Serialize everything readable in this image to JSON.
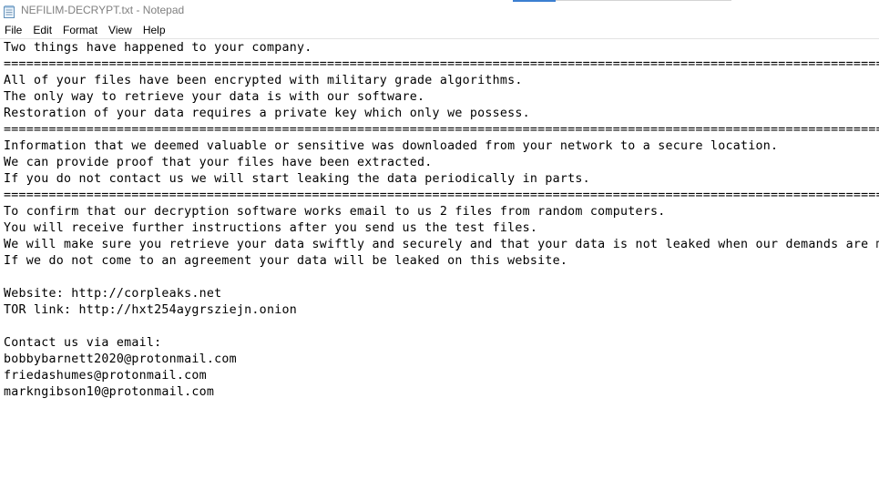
{
  "window": {
    "title": "NEFILIM-DECRYPT.txt - Notepad",
    "app_icon": "notepad-icon"
  },
  "menu": {
    "file": "File",
    "edit": "Edit",
    "format": "Format",
    "view": "View",
    "help": "Help"
  },
  "document": {
    "content": "Two things have happened to your company.\n=========================================================================================================================\nAll of your files have been encrypted with military grade algorithms.\nThe only way to retrieve your data is with our software.\nRestoration of your data requires a private key which only we possess.\n=========================================================================================================================\nInformation that we deemed valuable or sensitive was downloaded from your network to a secure location.\nWe can provide proof that your files have been extracted.\nIf you do not contact us we will start leaking the data periodically in parts.\n=========================================================================================================================\nTo confirm that our decryption software works email to us 2 files from random computers.\nYou will receive further instructions after you send us the test files.\nWe will make sure you retrieve your data swiftly and securely and that your data is not leaked when our demands are met.\nIf we do not come to an agreement your data will be leaked on this website.\n\nWebsite: http://corpleaks.net\nTOR link: http://hxt254aygrsziejn.onion\n\nContact us via email:\nbobbybarnett2020@protonmail.com\nfriedashumes@protonmail.com\nmarkngibson10@protonmail.com"
  }
}
